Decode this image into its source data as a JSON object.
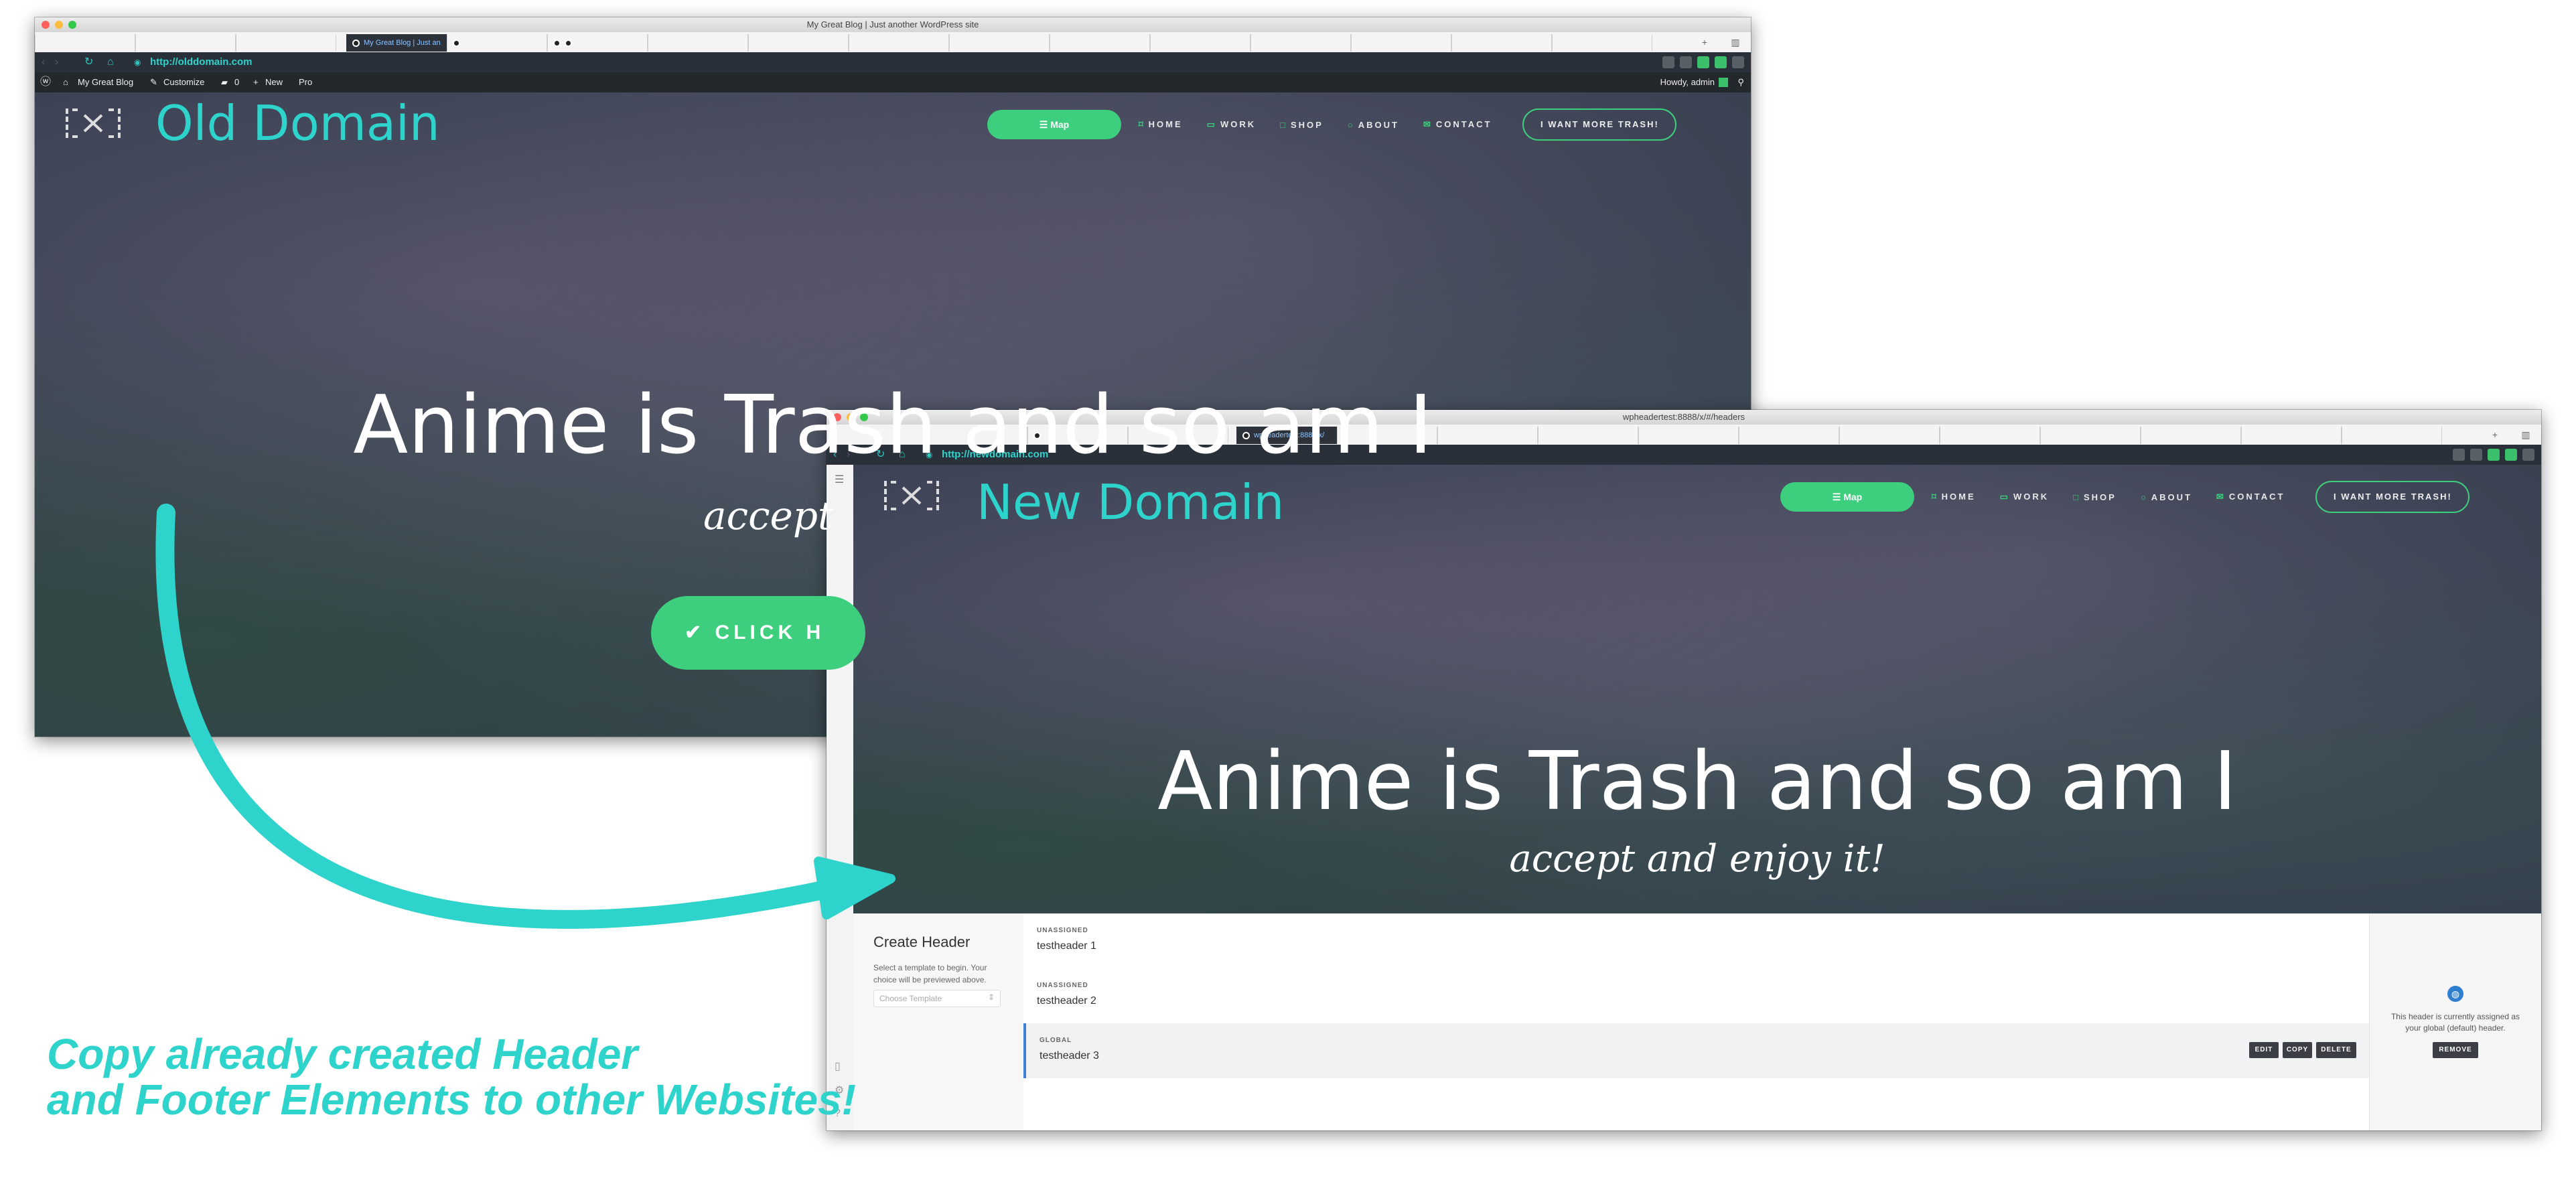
{
  "accent": "#2ed3cb",
  "button_green": "#3ecf7e",
  "old_site": {
    "window_title": "My Great Blog | Just another WordPress site",
    "active_tab": "My Great Blog | Just an",
    "url": "http://olddomain.com",
    "admin_bar": {
      "site_name": "My Great Blog",
      "customize": "Customize",
      "comments_count": "0",
      "new": "New",
      "pro": "Pro",
      "howdy": "Howdy, admin"
    },
    "site_title": "Old Domain",
    "map_button": "Map",
    "nav": [
      "HOME",
      "WORK",
      "SHOP",
      "ABOUT",
      "CONTACT"
    ],
    "cta": "I WANT MORE TRASH!",
    "hero_title": "Anime is Trash and so am I",
    "hero_sub": "accept",
    "click_button": "CLICK H"
  },
  "new_site": {
    "window_title": "wpheadertest:8888/x/#/headers",
    "active_tab": "wpheadertest:8888/x/",
    "url": "http://newdomain.com",
    "site_title": "New Domain",
    "map_button": "Map",
    "nav": [
      "HOME",
      "WORK",
      "SHOP",
      "ABOUT",
      "CONTACT"
    ],
    "cta": "I WANT MORE TRASH!",
    "hero_title": "Anime is Trash and so am I",
    "hero_sub": "accept and enjoy it!",
    "panel": {
      "create_title": "Create Header",
      "create_help": "Select a template to begin. Your choice will be previewed above.",
      "template_placeholder": "Choose Template",
      "headers": [
        {
          "status": "UNASSIGNED",
          "name": "testheader 1"
        },
        {
          "status": "UNASSIGNED",
          "name": "testheader 2"
        },
        {
          "status": "GLOBAL",
          "name": "testheader 3"
        }
      ],
      "edit": "EDIT",
      "copy": "COPY",
      "delete": "DELETE",
      "assigned_note": "This header is currently assigned as your global (default) header.",
      "remove": "REMOVE"
    }
  },
  "caption": {
    "line1": "Copy already created Header",
    "line2": "and Footer Elements to other Websites!"
  }
}
